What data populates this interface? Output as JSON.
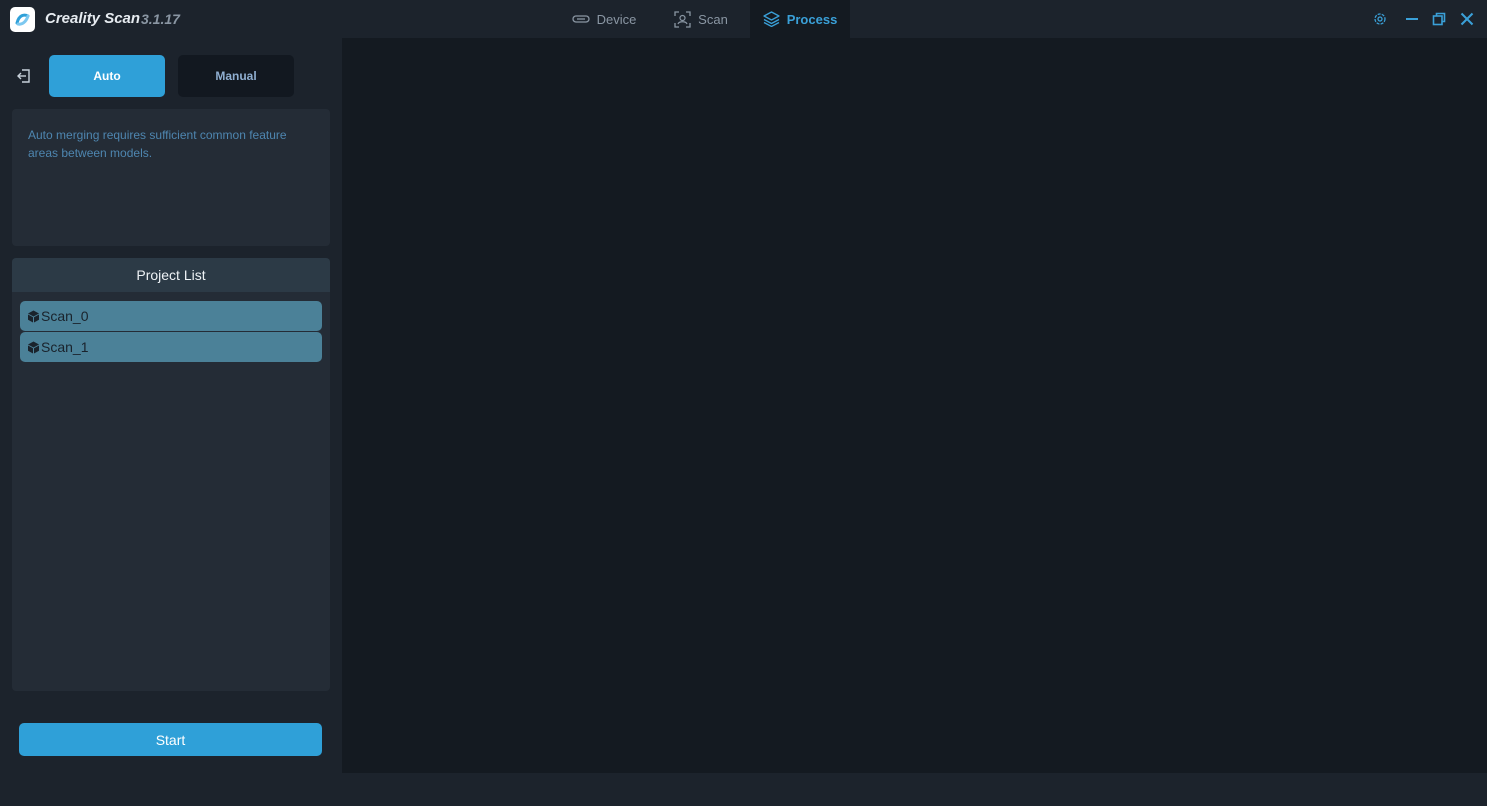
{
  "app": {
    "name": "Creality Scan",
    "version": "3.1.17"
  },
  "nav": {
    "tabs": [
      {
        "label": "Device",
        "icon": "device-icon",
        "active": false
      },
      {
        "label": "Scan",
        "icon": "scan-icon",
        "active": false
      },
      {
        "label": "Process",
        "icon": "layers-icon",
        "active": true
      }
    ]
  },
  "window_controls": [
    "settings-icon",
    "minimize-icon",
    "restore-icon",
    "close-icon"
  ],
  "sidebar": {
    "modes": {
      "auto_label": "Auto",
      "manual_label": "Manual",
      "selected": "Auto"
    },
    "info_text": "Auto merging requires sufficient common feature areas between models.",
    "project_list": {
      "title": "Project List",
      "items": [
        {
          "label": "Scan_0",
          "icon": "cube-icon"
        },
        {
          "label": "Scan_1",
          "icon": "cube-icon"
        }
      ]
    },
    "start_label": "Start"
  },
  "colors": {
    "accent": "#2fa0d8",
    "background": "#1c232c",
    "viewport": "#141a21",
    "panel": "#242c36",
    "list_item": "#4b8198"
  }
}
